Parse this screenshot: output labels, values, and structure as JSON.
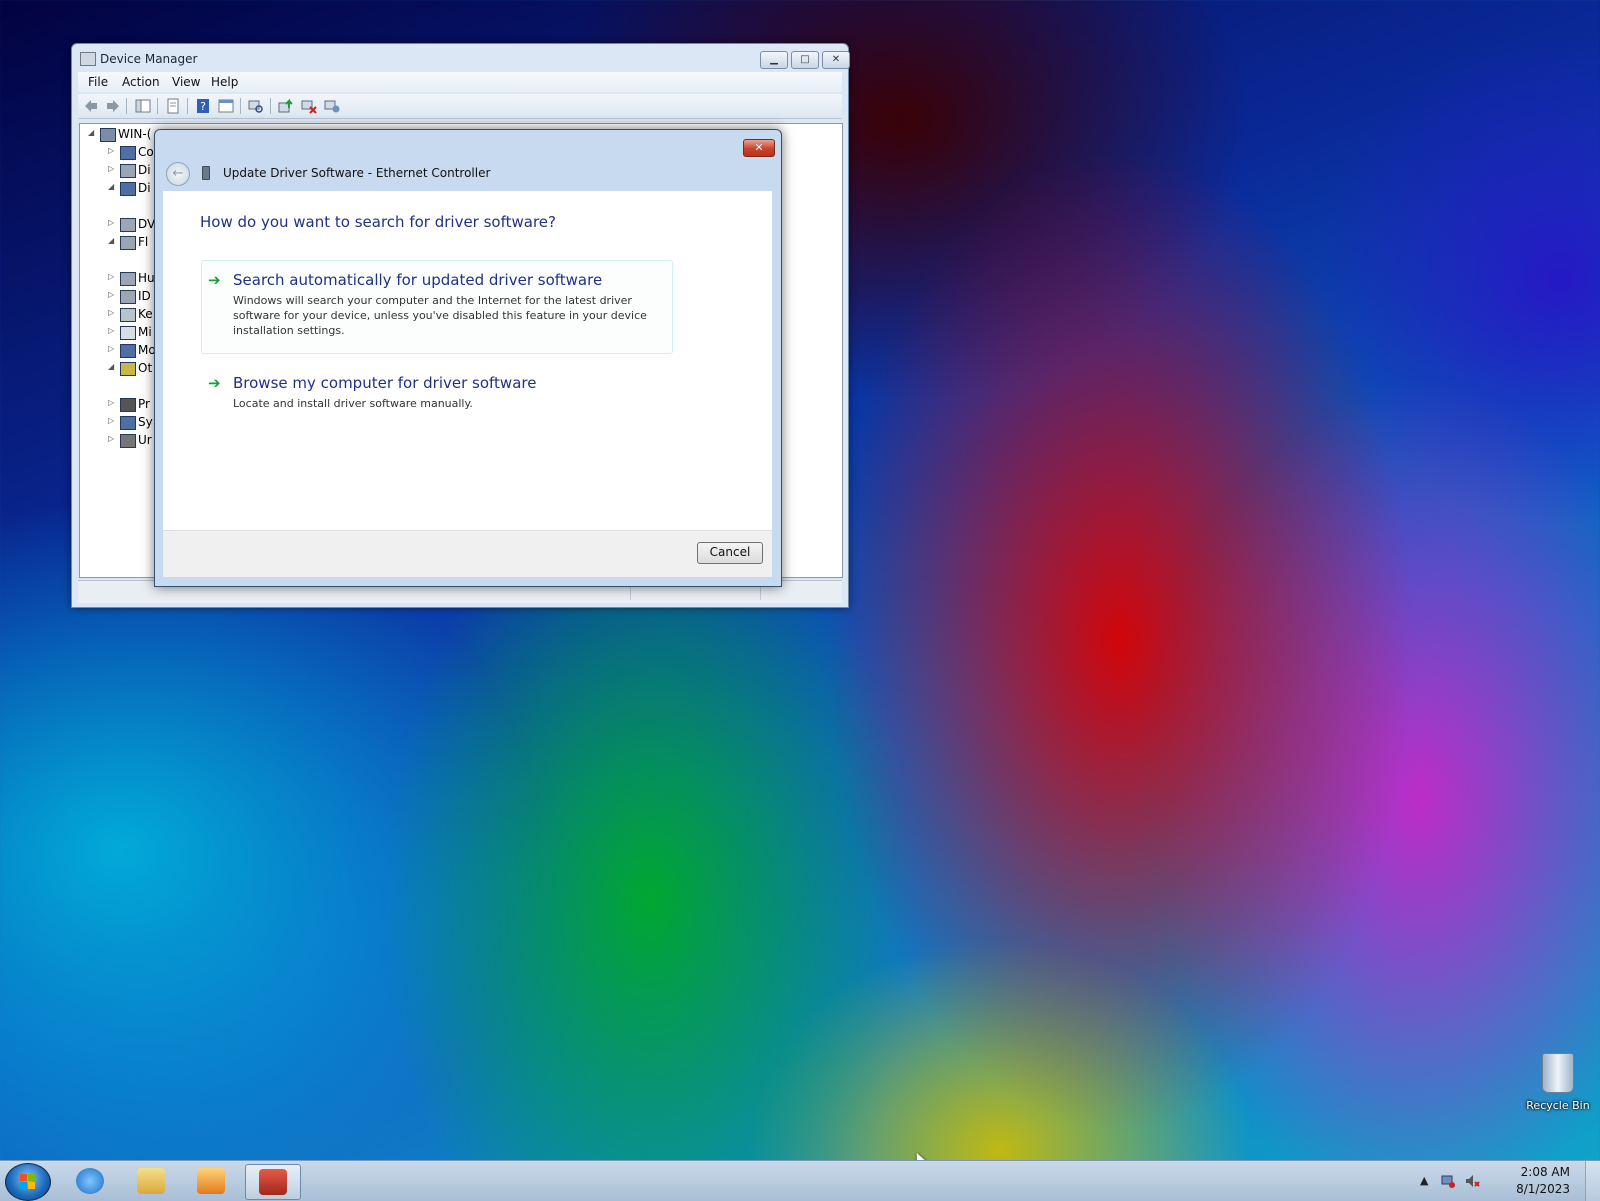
{
  "device_manager": {
    "title": "Device Manager",
    "menu": [
      "File",
      "Action",
      "View",
      "Help"
    ],
    "tree": {
      "root": "WIN-(",
      "items": [
        "Co",
        "Di",
        "Di",
        "DV",
        "Fl",
        "Hu",
        "ID",
        "Ke",
        "Mi",
        "Mo",
        "Ot",
        "Pr",
        "Sy",
        "Ur"
      ]
    }
  },
  "dialog": {
    "title": "Update Driver Software - Ethernet Controller",
    "close_glyph": "✕",
    "back_glyph": "←",
    "question": "How do you want to search for driver software?",
    "options": [
      {
        "title": "Search automatically for updated driver software",
        "description": "Windows will search your computer and the Internet for the latest driver software for your device, unless you've disabled this feature in your device installation settings."
      },
      {
        "title": "Browse my computer for driver software",
        "description": "Locate and install driver software manually."
      }
    ],
    "arrow_glyph": "➔",
    "cancel_label": "Cancel"
  },
  "desktop": {
    "recycle_bin_label": "Recycle Bin"
  },
  "taskbar": {
    "apps": [
      "start-button",
      "internet-explorer",
      "windows-explorer",
      "media-player",
      "device-manager"
    ],
    "tray_up_glyph": "▲",
    "time": "2:08 AM",
    "date": "8/1/2023"
  },
  "colors": {
    "accent_text": "#1e3287",
    "option_arrow": "#12a03a",
    "close_button": "#c7412b"
  }
}
